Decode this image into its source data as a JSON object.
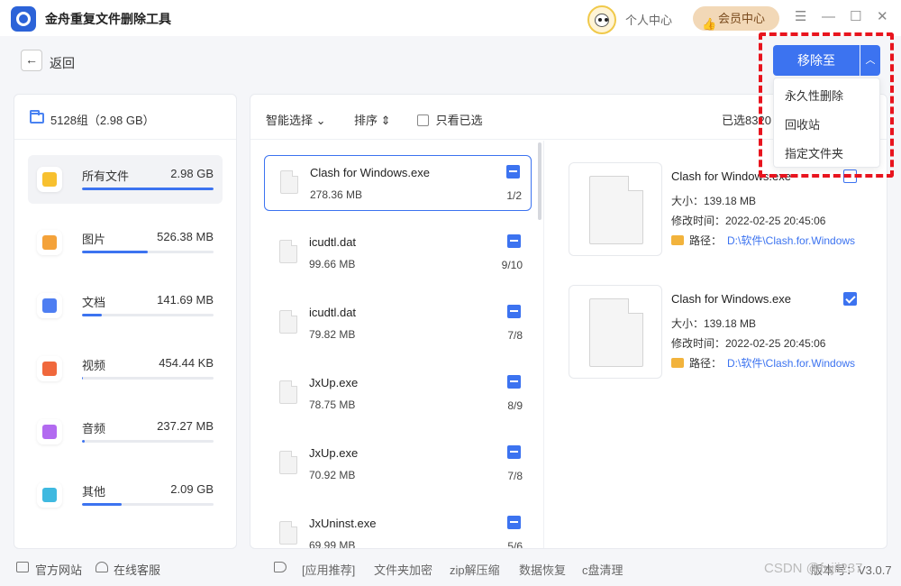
{
  "app": {
    "title": "金舟重复文件删除工具"
  },
  "header": {
    "personal_center": "个人中心",
    "vip_center": "会员中心",
    "vip_icon": "👍",
    "menu_icon": "☰",
    "min_icon": "—",
    "max_icon": "☐",
    "close_icon": "✕"
  },
  "nav": {
    "back_label": "返回",
    "back_icon": "←"
  },
  "group": {
    "label": "5128组（2.98 GB）"
  },
  "categories": [
    {
      "name": "所有文件",
      "size": "2.98 GB",
      "progress": 1.0,
      "color": "#f7c02f"
    },
    {
      "name": "图片",
      "size": "526.38 MB",
      "progress": 0.5,
      "color": "#f4a23a"
    },
    {
      "name": "文档",
      "size": "141.69 MB",
      "progress": 0.15,
      "color": "#4e7ef2"
    },
    {
      "name": "视频",
      "size": "454.44 KB",
      "progress": 0.0,
      "color": "#f0683c"
    },
    {
      "name": "音频",
      "size": "237.27 MB",
      "progress": 0.01,
      "color": "#b26af0"
    },
    {
      "name": "其他",
      "size": "2.09 GB",
      "progress": 0.3,
      "color": "#3fb9e0"
    }
  ],
  "toolbar": {
    "smart_select": "智能选择",
    "smart_arrow": "⌄",
    "sort": "排序",
    "sort_arrow": "⇕",
    "only_selected": "只看已选",
    "selected_count": "已选8320"
  },
  "files": [
    {
      "name": "Clash for Windows.exe",
      "size": "278.36 MB",
      "count": "1/2"
    },
    {
      "name": "icudtl.dat",
      "size": "99.66 MB",
      "count": "9/10"
    },
    {
      "name": "icudtl.dat",
      "size": "79.82 MB",
      "count": "7/8"
    },
    {
      "name": "JxUp.exe",
      "size": "78.75 MB",
      "count": "8/9"
    },
    {
      "name": "JxUp.exe",
      "size": "70.92 MB",
      "count": "7/8"
    },
    {
      "name": "JxUninst.exe",
      "size": "69.99 MB",
      "count": "5/6"
    }
  ],
  "details": [
    {
      "name": "Clash for Windows.exe",
      "size": "大小：139.18 MB",
      "mtime": "修改时间：2022-02-25 20:45:06",
      "path_label": "路径：",
      "path": "D:\\软件\\Clash.for.Windows",
      "checked": false
    },
    {
      "name": "Clash for Windows.exe",
      "size": "大小：139.18 MB",
      "mtime": "修改时间：2022-02-25 20:45:06",
      "path_label": "路径：",
      "path": "D:\\软件\\Clash.for.Windows",
      "checked": true
    }
  ],
  "move": {
    "label": "移除至",
    "arrow": "︿",
    "options": [
      "永久性删除",
      "回收站",
      "指定文件夹"
    ]
  },
  "footer": {
    "official_site": "官方网站",
    "online_service": "在线客服",
    "recommend": "[应用推荐]",
    "encrypt": "文件夹加密",
    "zip": "zip解压缩",
    "recover": "数据恢复",
    "cclean": "c盘清理",
    "version": "版本号：V3.0.7"
  },
  "watermark": "CSDN @fujii237"
}
